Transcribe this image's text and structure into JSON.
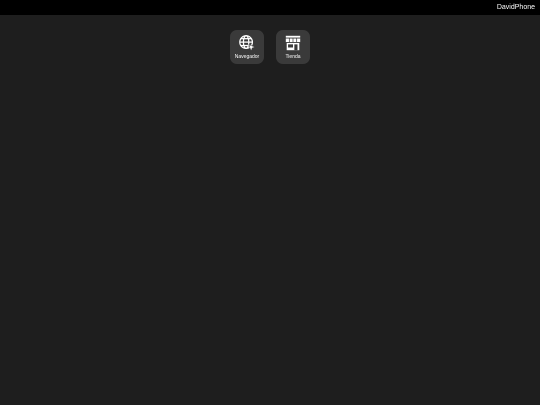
{
  "status_bar": {
    "device_name": "DavidPhone"
  },
  "home": {
    "apps": [
      {
        "id": "browser",
        "label": "Navegador",
        "icon": "globe-icon"
      },
      {
        "id": "store",
        "label": "Tienda",
        "icon": "storefront-icon"
      }
    ]
  },
  "colors": {
    "background": "#1e1e1e",
    "status_bar": "#000000",
    "app_tile": "#3a3a3a",
    "text": "#ffffff"
  }
}
